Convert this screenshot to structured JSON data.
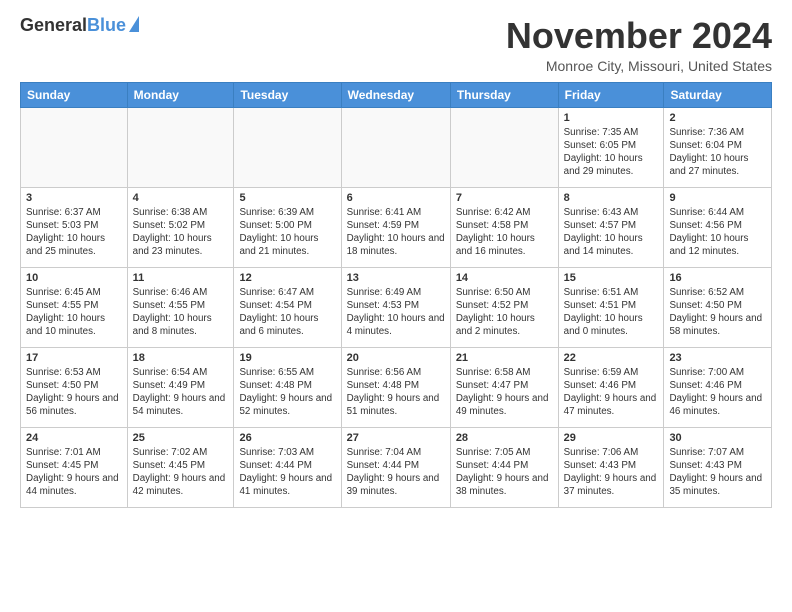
{
  "header": {
    "logo_line1": "General",
    "logo_line2": "Blue",
    "month": "November 2024",
    "location": "Monroe City, Missouri, United States"
  },
  "days_of_week": [
    "Sunday",
    "Monday",
    "Tuesday",
    "Wednesday",
    "Thursday",
    "Friday",
    "Saturday"
  ],
  "weeks": [
    [
      {
        "day": "",
        "info": ""
      },
      {
        "day": "",
        "info": ""
      },
      {
        "day": "",
        "info": ""
      },
      {
        "day": "",
        "info": ""
      },
      {
        "day": "",
        "info": ""
      },
      {
        "day": "1",
        "info": "Sunrise: 7:35 AM\nSunset: 6:05 PM\nDaylight: 10 hours\nand 29 minutes."
      },
      {
        "day": "2",
        "info": "Sunrise: 7:36 AM\nSunset: 6:04 PM\nDaylight: 10 hours\nand 27 minutes."
      }
    ],
    [
      {
        "day": "3",
        "info": "Sunrise: 6:37 AM\nSunset: 5:03 PM\nDaylight: 10 hours\nand 25 minutes."
      },
      {
        "day": "4",
        "info": "Sunrise: 6:38 AM\nSunset: 5:02 PM\nDaylight: 10 hours\nand 23 minutes."
      },
      {
        "day": "5",
        "info": "Sunrise: 6:39 AM\nSunset: 5:00 PM\nDaylight: 10 hours\nand 21 minutes."
      },
      {
        "day": "6",
        "info": "Sunrise: 6:41 AM\nSunset: 4:59 PM\nDaylight: 10 hours\nand 18 minutes."
      },
      {
        "day": "7",
        "info": "Sunrise: 6:42 AM\nSunset: 4:58 PM\nDaylight: 10 hours\nand 16 minutes."
      },
      {
        "day": "8",
        "info": "Sunrise: 6:43 AM\nSunset: 4:57 PM\nDaylight: 10 hours\nand 14 minutes."
      },
      {
        "day": "9",
        "info": "Sunrise: 6:44 AM\nSunset: 4:56 PM\nDaylight: 10 hours\nand 12 minutes."
      }
    ],
    [
      {
        "day": "10",
        "info": "Sunrise: 6:45 AM\nSunset: 4:55 PM\nDaylight: 10 hours\nand 10 minutes."
      },
      {
        "day": "11",
        "info": "Sunrise: 6:46 AM\nSunset: 4:55 PM\nDaylight: 10 hours\nand 8 minutes."
      },
      {
        "day": "12",
        "info": "Sunrise: 6:47 AM\nSunset: 4:54 PM\nDaylight: 10 hours\nand 6 minutes."
      },
      {
        "day": "13",
        "info": "Sunrise: 6:49 AM\nSunset: 4:53 PM\nDaylight: 10 hours\nand 4 minutes."
      },
      {
        "day": "14",
        "info": "Sunrise: 6:50 AM\nSunset: 4:52 PM\nDaylight: 10 hours\nand 2 minutes."
      },
      {
        "day": "15",
        "info": "Sunrise: 6:51 AM\nSunset: 4:51 PM\nDaylight: 10 hours\nand 0 minutes."
      },
      {
        "day": "16",
        "info": "Sunrise: 6:52 AM\nSunset: 4:50 PM\nDaylight: 9 hours\nand 58 minutes."
      }
    ],
    [
      {
        "day": "17",
        "info": "Sunrise: 6:53 AM\nSunset: 4:50 PM\nDaylight: 9 hours\nand 56 minutes."
      },
      {
        "day": "18",
        "info": "Sunrise: 6:54 AM\nSunset: 4:49 PM\nDaylight: 9 hours\nand 54 minutes."
      },
      {
        "day": "19",
        "info": "Sunrise: 6:55 AM\nSunset: 4:48 PM\nDaylight: 9 hours\nand 52 minutes."
      },
      {
        "day": "20",
        "info": "Sunrise: 6:56 AM\nSunset: 4:48 PM\nDaylight: 9 hours\nand 51 minutes."
      },
      {
        "day": "21",
        "info": "Sunrise: 6:58 AM\nSunset: 4:47 PM\nDaylight: 9 hours\nand 49 minutes."
      },
      {
        "day": "22",
        "info": "Sunrise: 6:59 AM\nSunset: 4:46 PM\nDaylight: 9 hours\nand 47 minutes."
      },
      {
        "day": "23",
        "info": "Sunrise: 7:00 AM\nSunset: 4:46 PM\nDaylight: 9 hours\nand 46 minutes."
      }
    ],
    [
      {
        "day": "24",
        "info": "Sunrise: 7:01 AM\nSunset: 4:45 PM\nDaylight: 9 hours\nand 44 minutes."
      },
      {
        "day": "25",
        "info": "Sunrise: 7:02 AM\nSunset: 4:45 PM\nDaylight: 9 hours\nand 42 minutes."
      },
      {
        "day": "26",
        "info": "Sunrise: 7:03 AM\nSunset: 4:44 PM\nDaylight: 9 hours\nand 41 minutes."
      },
      {
        "day": "27",
        "info": "Sunrise: 7:04 AM\nSunset: 4:44 PM\nDaylight: 9 hours\nand 39 minutes."
      },
      {
        "day": "28",
        "info": "Sunrise: 7:05 AM\nSunset: 4:44 PM\nDaylight: 9 hours\nand 38 minutes."
      },
      {
        "day": "29",
        "info": "Sunrise: 7:06 AM\nSunset: 4:43 PM\nDaylight: 9 hours\nand 37 minutes."
      },
      {
        "day": "30",
        "info": "Sunrise: 7:07 AM\nSunset: 4:43 PM\nDaylight: 9 hours\nand 35 minutes."
      }
    ]
  ]
}
